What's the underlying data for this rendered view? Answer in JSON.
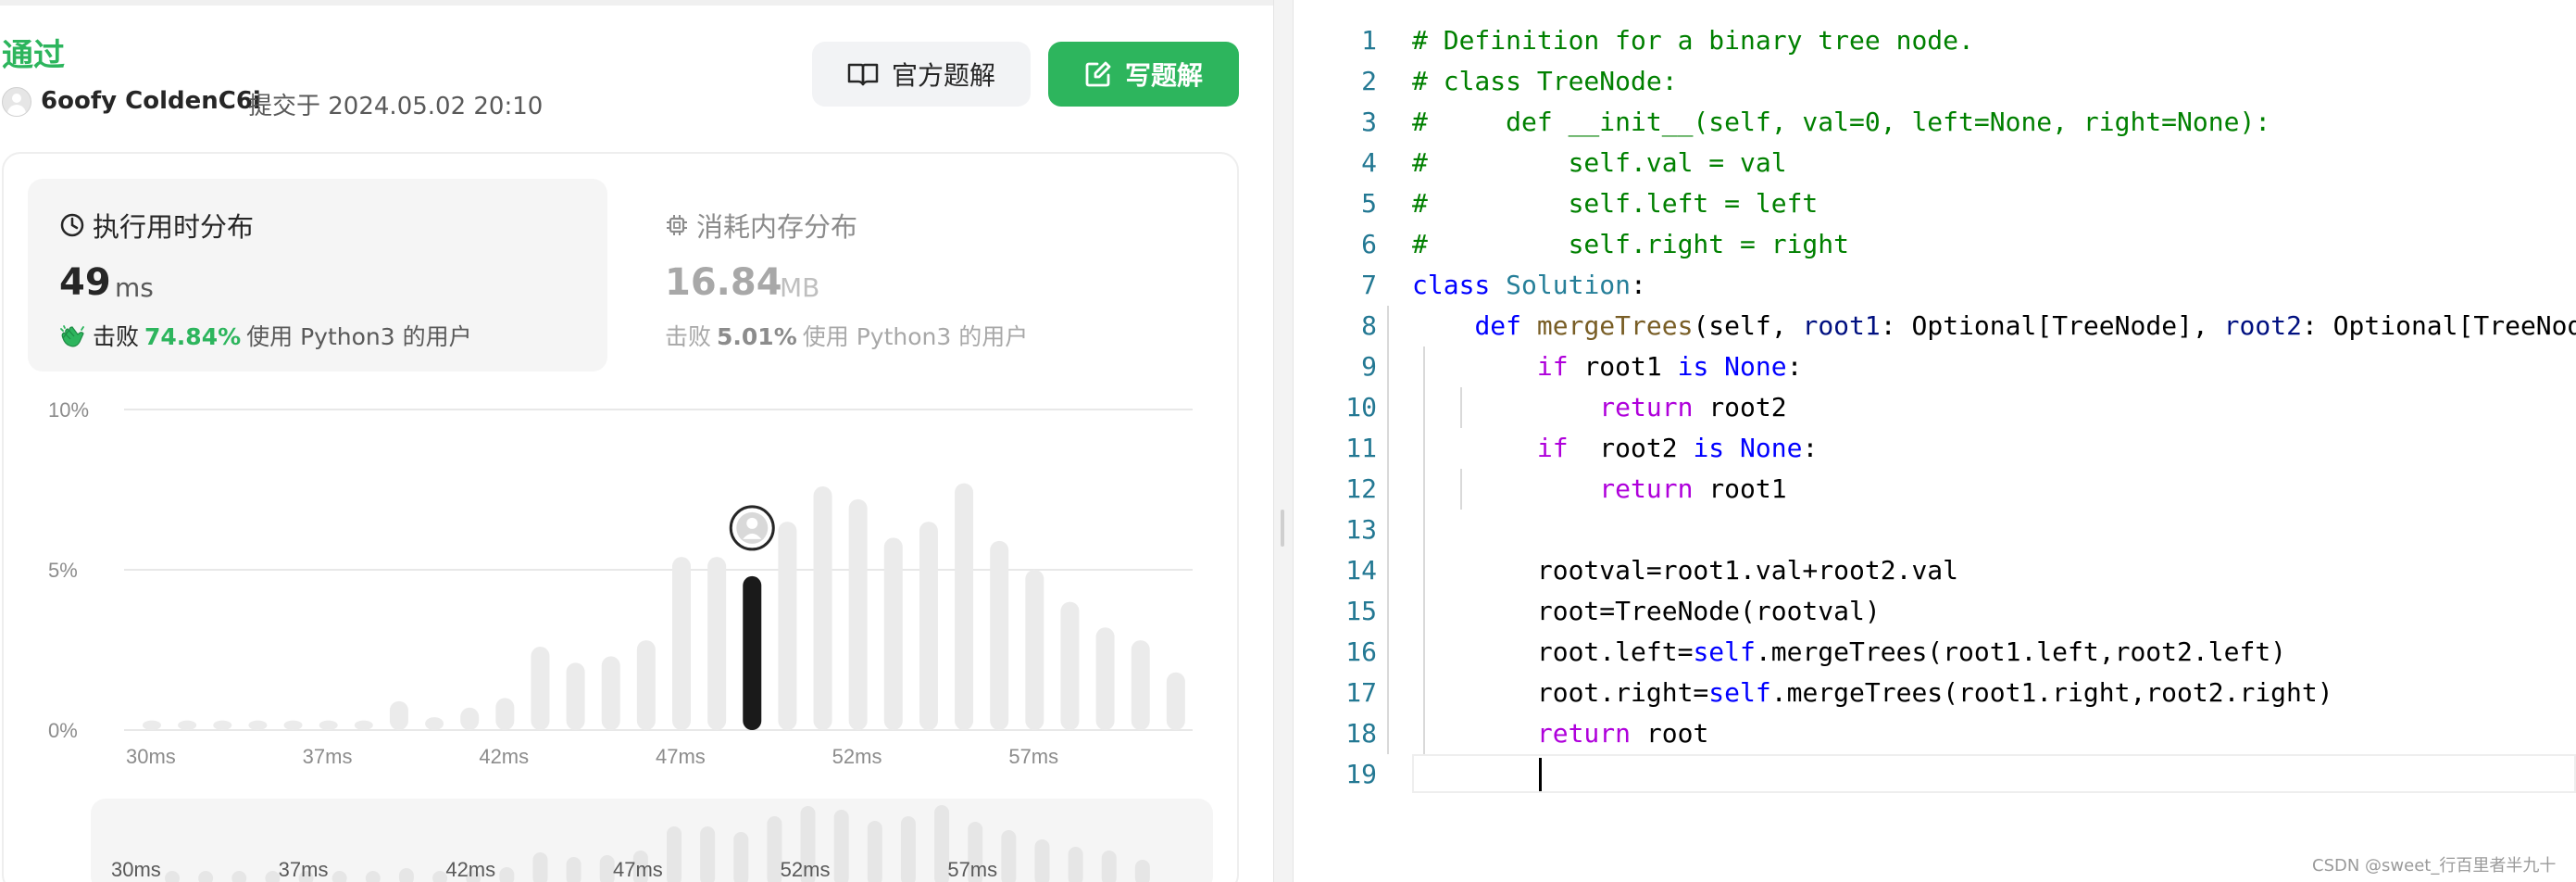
{
  "result": {
    "status": "通过",
    "user": "6oofy ColdenC6i",
    "submitted": "提交于 2024.05.02 20:10",
    "buttons": {
      "official": "官方题解",
      "write": "写题解"
    }
  },
  "runtime": {
    "title": "执行用时分布",
    "value": "49",
    "unit": "ms",
    "beats_label": "击败",
    "beats_pct": "74.84%",
    "beats_suffix": "使用 Python3 的用户"
  },
  "memory": {
    "title": "消耗内存分布",
    "value": "16.84",
    "unit": "MB",
    "beats_label": "击败",
    "beats_pct": "5.01%",
    "beats_suffix": "使用 Python3 的用户"
  },
  "colors": {
    "accent": "#2db55d",
    "bar": "#ebebeb",
    "selected_bar": "#1a1a1a"
  },
  "chart_data": {
    "type": "bar",
    "y_ticks": [
      "10%",
      "5%",
      "0%"
    ],
    "ylim": [
      0,
      10
    ],
    "x_ticks": [
      "30ms",
      "37ms",
      "42ms",
      "47ms",
      "52ms",
      "57ms"
    ],
    "values": [
      0.3,
      0.3,
      0.3,
      0.3,
      0.3,
      0.3,
      0.3,
      0.9,
      0.4,
      0.7,
      1.0,
      2.6,
      2.1,
      2.3,
      2.8,
      5.4,
      5.4,
      4.8,
      6.5,
      7.6,
      7.2,
      6.0,
      6.5,
      7.7,
      5.9,
      5.0,
      4.0,
      3.2,
      2.8,
      1.8
    ],
    "selected_index": 17,
    "mini_values": [
      0.3,
      0.3,
      0.3,
      0.3,
      0.3,
      0.3,
      0.3,
      0.9,
      0.4,
      0.7,
      1.0,
      2.6,
      2.1,
      2.3,
      2.8,
      5.4,
      5.4,
      4.8,
      6.5,
      7.6,
      7.2,
      6.0,
      6.5,
      7.7,
      5.9,
      5.0,
      4.0,
      3.2,
      2.8,
      1.8
    ],
    "mini_x_ticks": [
      "30ms",
      "37ms",
      "42ms",
      "47ms",
      "52ms",
      "57ms"
    ]
  },
  "code": {
    "line_numbers": [
      "1",
      "2",
      "3",
      "4",
      "5",
      "6",
      "7",
      "8",
      "9",
      "10",
      "11",
      "12",
      "13",
      "14",
      "15",
      "16",
      "17",
      "18",
      "19"
    ],
    "lines": [
      [
        {
          "t": "# Definition for a binary tree node.",
          "c": "cm"
        }
      ],
      [
        {
          "t": "# class TreeNode:",
          "c": "cm"
        }
      ],
      [
        {
          "t": "#     def __init__(self, val=0, left=None, right=None):",
          "c": "cm"
        }
      ],
      [
        {
          "t": "#         self.val = val",
          "c": "cm"
        }
      ],
      [
        {
          "t": "#         self.left = left",
          "c": "cm"
        }
      ],
      [
        {
          "t": "#         self.right = right",
          "c": "cm"
        }
      ],
      [
        {
          "t": "class ",
          "c": "kw"
        },
        {
          "t": "Solution",
          "c": "cls"
        },
        {
          "t": ":",
          "c": ""
        }
      ],
      [
        {
          "t": "    ",
          "c": ""
        },
        {
          "t": "def ",
          "c": "kw"
        },
        {
          "t": "mergeTrees",
          "c": "fn"
        },
        {
          "t": "(self, ",
          "c": ""
        },
        {
          "t": "root1",
          "c": "pr"
        },
        {
          "t": ": Optional[TreeNode], ",
          "c": ""
        },
        {
          "t": "root2",
          "c": "pr"
        },
        {
          "t": ": Optional[TreeNode]",
          "c": ""
        }
      ],
      [
        {
          "t": "        ",
          "c": ""
        },
        {
          "t": "if ",
          "c": "kc"
        },
        {
          "t": "root1 ",
          "c": ""
        },
        {
          "t": "is None",
          "c": "kw"
        },
        {
          "t": ":",
          "c": ""
        }
      ],
      [
        {
          "t": "            ",
          "c": ""
        },
        {
          "t": "return ",
          "c": "kc"
        },
        {
          "t": "root2",
          "c": ""
        }
      ],
      [
        {
          "t": "        ",
          "c": ""
        },
        {
          "t": "if  ",
          "c": "kc"
        },
        {
          "t": "root2 ",
          "c": ""
        },
        {
          "t": "is None",
          "c": "kw"
        },
        {
          "t": ":",
          "c": ""
        }
      ],
      [
        {
          "t": "            ",
          "c": ""
        },
        {
          "t": "return ",
          "c": "kc"
        },
        {
          "t": "root1",
          "c": ""
        }
      ],
      [
        {
          "t": "",
          "c": ""
        }
      ],
      [
        {
          "t": "        rootval=root1.val+root2.val",
          "c": ""
        }
      ],
      [
        {
          "t": "        root=TreeNode(rootval)",
          "c": ""
        }
      ],
      [
        {
          "t": "        root.left=",
          "c": ""
        },
        {
          "t": "self",
          "c": "kw"
        },
        {
          "t": ".mergeTrees(root1.left,root2.left)",
          "c": ""
        }
      ],
      [
        {
          "t": "        root.right=",
          "c": ""
        },
        {
          "t": "self",
          "c": "kw"
        },
        {
          "t": ".mergeTrees(root1.right,root2.right)",
          "c": ""
        }
      ],
      [
        {
          "t": "        ",
          "c": ""
        },
        {
          "t": "return ",
          "c": "kc"
        },
        {
          "t": "root",
          "c": ""
        }
      ],
      [
        {
          "t": "        ",
          "c": ""
        }
      ]
    ]
  },
  "watermark": "CSDN @sweet_行百里者半九十"
}
